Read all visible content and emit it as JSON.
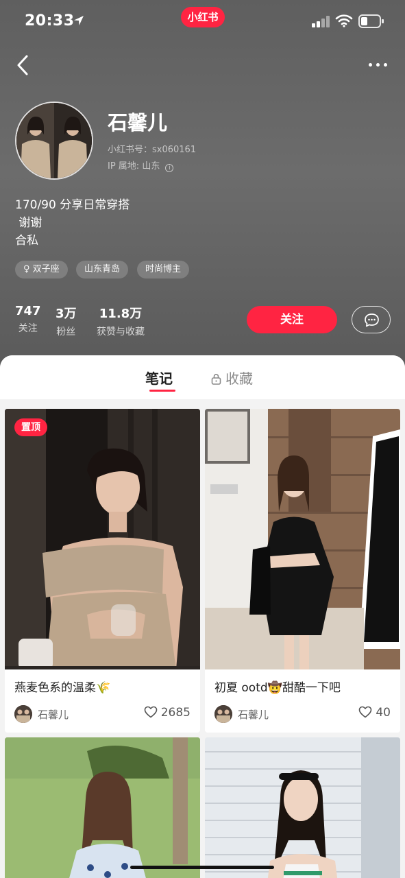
{
  "status_bar": {
    "time": "20:33",
    "app_badge": "小红书"
  },
  "profile": {
    "name": "石馨儿",
    "id_line": "小红书号：sx060161",
    "ip_line": "IP 属地: 山东",
    "bio": [
      "170/90 分享日常穿搭",
      " 谢谢",
      "合私"
    ],
    "tags": [
      "♀ 双子座",
      "山东青岛",
      "时尚博主"
    ]
  },
  "stats": [
    {
      "num": "747",
      "label": "关注"
    },
    {
      "num": "3万",
      "label": "粉丝"
    },
    {
      "num": "11.8万",
      "label": "获赞与收藏"
    }
  ],
  "actions": {
    "follow": "关注"
  },
  "tabs": {
    "notes": "笔记",
    "collect": "收藏"
  },
  "notes": [
    {
      "badge": "置顶",
      "title": "燕麦色系的温柔🌾",
      "author": "石馨儿",
      "likes": "2685"
    },
    {
      "title": "初夏 ootd🤠甜酷一下吧",
      "author": "石馨儿",
      "likes": "40"
    }
  ],
  "colors": {
    "accent": "#ff2442",
    "header_bg": "#666666"
  }
}
